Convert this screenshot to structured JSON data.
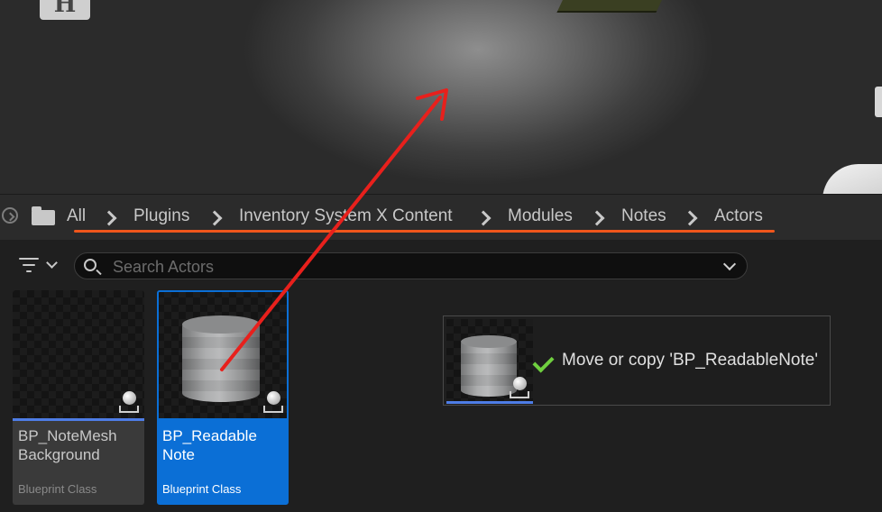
{
  "viewport": {
    "axis_gizmo_text": "H"
  },
  "breadcrumb": {
    "items": [
      "All",
      "Plugins",
      "Inventory System X Content",
      "Modules",
      "Notes",
      "Actors"
    ]
  },
  "search": {
    "placeholder": "Search Actors",
    "value": ""
  },
  "assets": [
    {
      "name": "BP_NoteMesh\nBackground",
      "type": "Blueprint Class",
      "selected": false
    },
    {
      "name": "BP_Readable\nNote",
      "type": "Blueprint Class",
      "selected": true
    }
  ],
  "drag_tooltip": {
    "text": "Move or copy 'BP_ReadableNote'",
    "status_icon": "check-icon"
  },
  "colors": {
    "selection": "#0b6fd6",
    "underline_annotation": "#f0561c",
    "arrow_annotation": "#e8201c",
    "check": "#6fcf3f"
  }
}
